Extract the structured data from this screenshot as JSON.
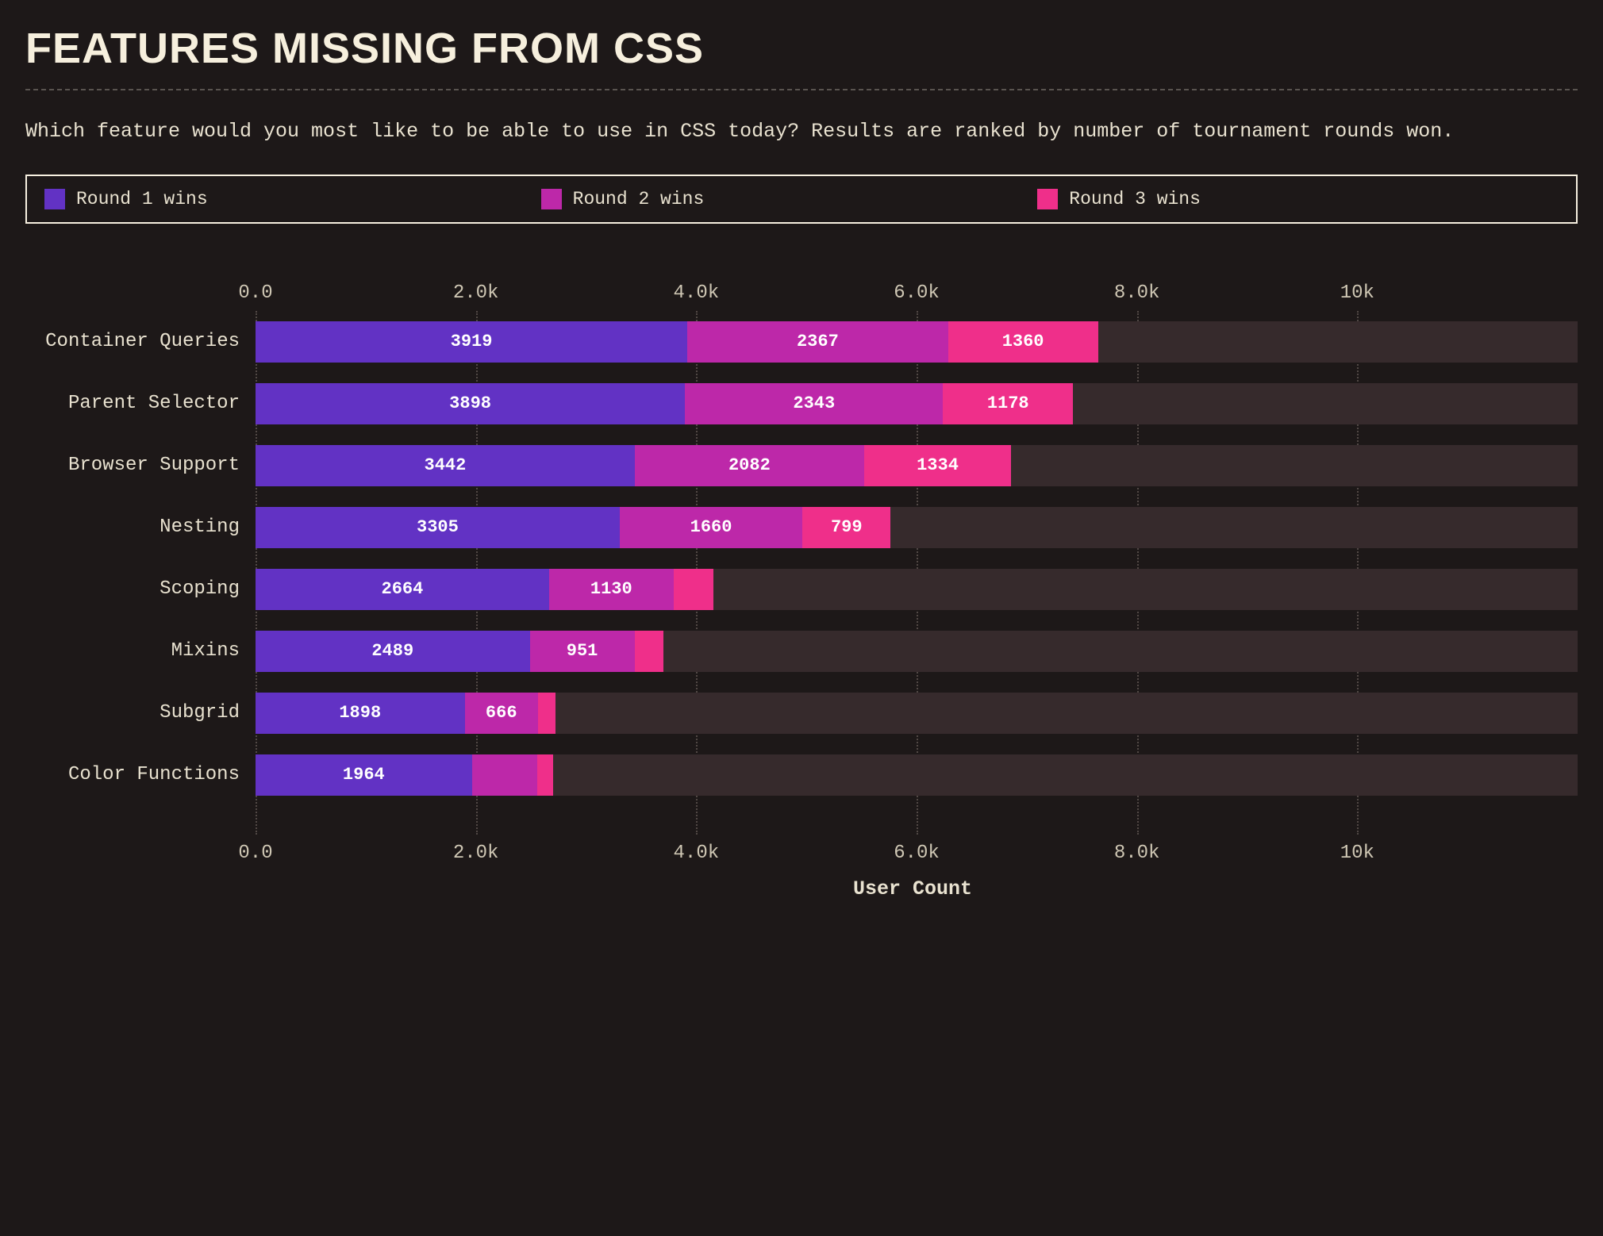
{
  "title": "FEATURES MISSING FROM CSS",
  "subtitle": "Which feature would you most like to be able to use in CSS today? Results are ranked by number of tournament rounds won.",
  "legend": [
    {
      "label": "Round 1 wins",
      "color": "#6232c4"
    },
    {
      "label": "Round 2 wins",
      "color": "#bd28a9"
    },
    {
      "label": "Round 3 wins",
      "color": "#ef2f8a"
    }
  ],
  "xlabel": "User Count",
  "x_ticks": [
    {
      "value": 0,
      "label": "0.0"
    },
    {
      "value": 2000,
      "label": "2.0k"
    },
    {
      "value": 4000,
      "label": "4.0k"
    },
    {
      "value": 6000,
      "label": "6.0k"
    },
    {
      "value": 8000,
      "label": "8.0k"
    },
    {
      "value": 10000,
      "label": "10k"
    }
  ],
  "x_max": 12000,
  "chart_data": {
    "type": "bar",
    "stacked": true,
    "orientation": "horizontal",
    "xlabel": "User Count",
    "xlim": [
      0,
      12000
    ],
    "categories": [
      "Container Queries",
      "Parent Selector",
      "Browser Support",
      "Nesting",
      "Scoping",
      "Mixins",
      "Subgrid",
      "Color Functions"
    ],
    "series": [
      {
        "name": "Round 1 wins",
        "color": "#6232c4",
        "values": [
          3919,
          3898,
          3442,
          3305,
          2664,
          2489,
          1898,
          1964
        ],
        "show_label": [
          true,
          true,
          true,
          true,
          true,
          true,
          true,
          true
        ]
      },
      {
        "name": "Round 2 wins",
        "color": "#bd28a9",
        "values": [
          2367,
          2343,
          2082,
          1660,
          1130,
          951,
          666,
          590
        ],
        "show_label": [
          true,
          true,
          true,
          true,
          true,
          true,
          true,
          false
        ]
      },
      {
        "name": "Round 3 wins",
        "color": "#ef2f8a",
        "values": [
          1360,
          1178,
          1334,
          799,
          360,
          260,
          160,
          150
        ],
        "show_label": [
          true,
          true,
          true,
          true,
          false,
          false,
          false,
          false
        ]
      }
    ]
  }
}
